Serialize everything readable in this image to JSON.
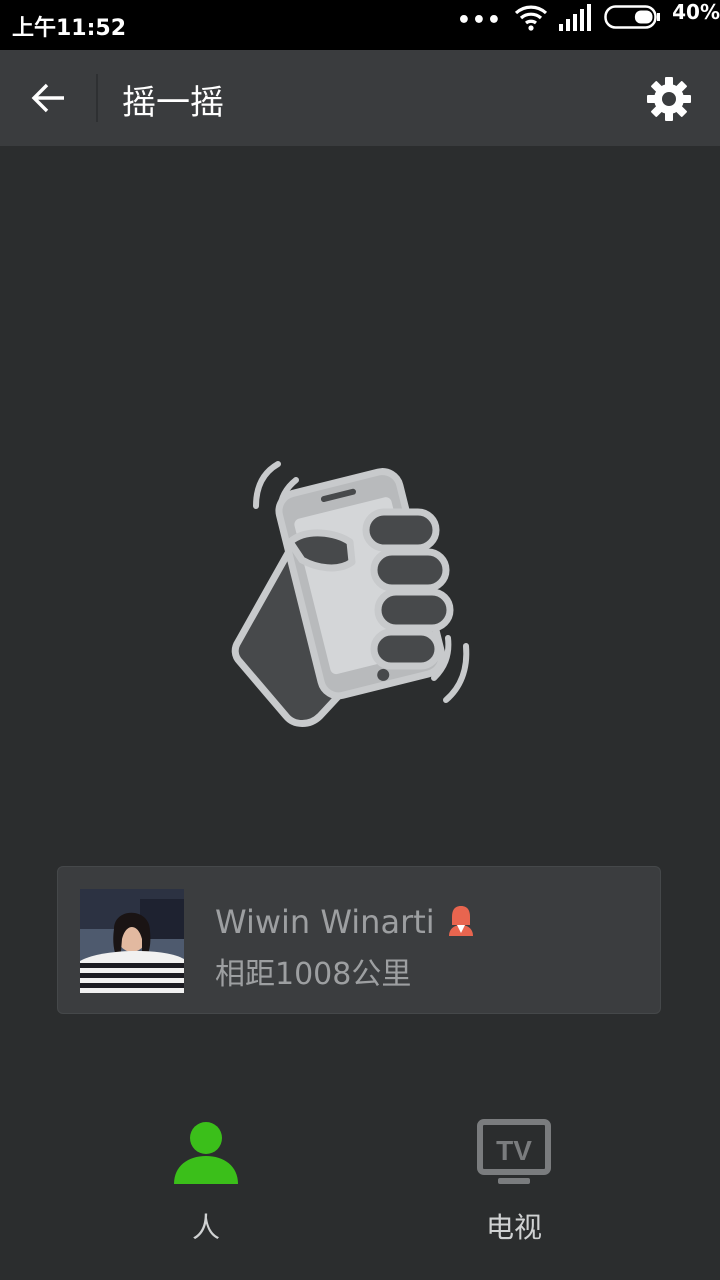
{
  "status_bar": {
    "time": "上午11:52",
    "dots": "•••",
    "battery_percent": "40%",
    "battery_level": 0.4
  },
  "toolbar": {
    "title": "摇一摇",
    "back_icon": "arrow-left-icon",
    "settings_icon": "gear-icon"
  },
  "illustration": {
    "icon": "shake-phone-hand-icon"
  },
  "result": {
    "name": "Wiwin Winarti",
    "distance": "相距1008公里",
    "gender_icon": "female-icon",
    "gender_color": "#e8654f"
  },
  "tabs": [
    {
      "label": "人",
      "icon": "person-icon",
      "active": true,
      "color": "#3bbf1a"
    },
    {
      "label": "电视",
      "icon": "tv-icon",
      "active": false,
      "color": "#7a7c7e"
    }
  ]
}
